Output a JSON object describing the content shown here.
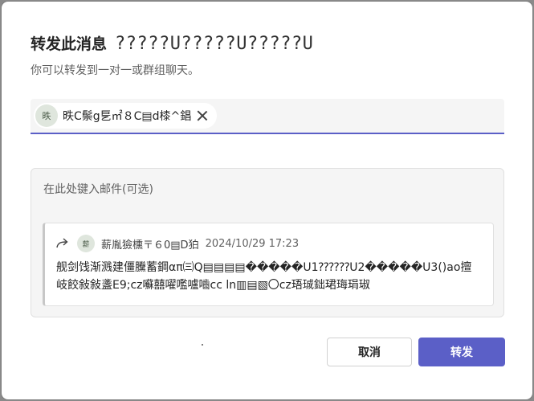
{
  "dialog": {
    "title": "转发此消息",
    "subject": "?????U?????U?????U",
    "subtitle": "你可以转发到一对一或群组聊天。"
  },
  "recipient": {
    "avatar_text": "昳",
    "name": "昳C鬃g乬㎡８C▤d㯃^錩",
    "remove_icon": "close-icon"
  },
  "message": {
    "placeholder": "在此处键入邮件(可选)"
  },
  "quote": {
    "icon": "forward-icon",
    "sender_avatar_text": "薪",
    "sender": "薪胤獫櫄〒６0▤D狛",
    "timestamp": "2024/10/29 17:23",
    "body": "舰剑饯渐溅建僵黱蓄鋼απ㈢Q▤▤▤▤�����U1⁇⁇⁇U2�����U3()ao擅岐餃敍敍盞E9;cz囌囍嚁嚂嚧嚙cc ln▥▤▧〇cz珸珹鈯珺珻琄琡"
  },
  "buttons": {
    "cancel": "取消",
    "forward": "转发"
  },
  "colors": {
    "accent": "#5b5fc7",
    "surface": "#f5f5f5"
  }
}
